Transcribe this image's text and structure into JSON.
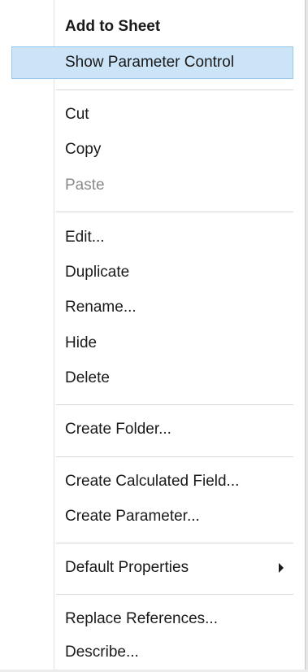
{
  "context_menu": {
    "items": [
      {
        "label": "Add to Sheet",
        "bold": true
      },
      {
        "label": "Show Parameter Control",
        "highlighted": true
      },
      {
        "label": "Cut"
      },
      {
        "label": "Copy"
      },
      {
        "label": "Paste",
        "disabled": true
      },
      {
        "label": "Edit..."
      },
      {
        "label": "Duplicate"
      },
      {
        "label": "Rename..."
      },
      {
        "label": "Hide"
      },
      {
        "label": "Delete"
      },
      {
        "label": "Create Folder..."
      },
      {
        "label": "Create Calculated Field..."
      },
      {
        "label": "Create Parameter..."
      },
      {
        "label": "Default Properties",
        "submenu_icon": "chevron-right-icon"
      },
      {
        "label": "Replace References..."
      },
      {
        "label": "Describe..."
      }
    ],
    "colors": {
      "highlight_background": "#cce4f7",
      "highlight_border": "#99c9ef",
      "disabled_text": "#8a8a8a",
      "text": "#1a1a1a"
    }
  }
}
